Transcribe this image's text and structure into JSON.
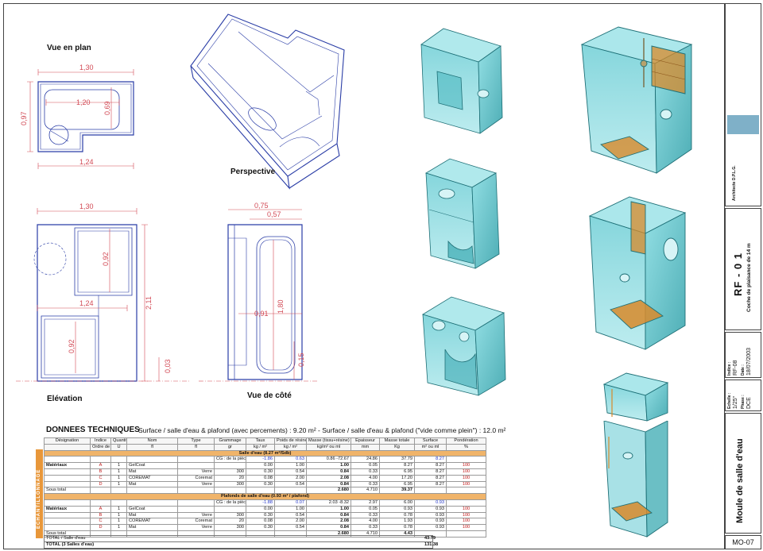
{
  "views": {
    "plan": "Vue en plan",
    "perspective": "Perspective",
    "elevation": "Elévation",
    "side": "Vue de côté"
  },
  "dimensions": {
    "plan_width": "1,30",
    "plan_inner": "1,20",
    "plan_height": "0,97",
    "plan_inner_height": "0,69",
    "plan_bottom": "1,24",
    "elev_width": "1,30",
    "elev_inner_top": "0,92",
    "elev_mid": "1,24",
    "elev_inner_bottom": "0,92",
    "elev_height": "2,11",
    "elev_base": "0,03",
    "side_top_a": "0,75",
    "side_top_b": "0,57",
    "side_inner": "1,80",
    "side_depth": "0,91",
    "side_base": "0,15"
  },
  "title_block": {
    "architect": "Architecte D.P.L.G.",
    "project_code": "RF - 0 1",
    "project_name": "Coche de plaisance de 14 m",
    "indice_label": "Indice :",
    "indice": "RF-08",
    "date_label": "Date :",
    "date": "18/07/2003",
    "echelle_label": "Echelle :",
    "echelle": "1/25°",
    "phase_label": "Phase :",
    "phase": "DCE",
    "drawing_title": "Moule de salle d'eau",
    "drawing_number": "MO-07"
  },
  "data_table": {
    "title": "DONNEES TECHNIQUES",
    "subtitle": "Surface / salle d'eau & plafond (avec percements) : 9.20 m² - Surface / salle d'eau & plafond (\"vide comme plein\") : 12.0 m²",
    "side_label": "ECHANTILLONNAGE",
    "headers": [
      "Désignation",
      "Indice",
      "Quantité",
      "Nom",
      "Type",
      "Grammage",
      "Taux",
      "Poids de résine",
      "Masse (tissu+résine)",
      "Epaisseur",
      "Masse totale",
      "Surface",
      "Pondération"
    ],
    "units": [
      "",
      "Ordre de pose",
      "U",
      "fl",
      "fl",
      "gr",
      "kg / m²",
      "kg / m²",
      "kg/m² ou ml",
      "mm",
      "Kg",
      "m² ou ml",
      "%"
    ],
    "sections": [
      {
        "title": "Salle d'eau (8.27 m²/Sdb)",
        "cg": {
          "label": "CG : de la pièce",
          "a": "-1.86",
          "b": "0.63",
          "c": "0.86",
          "d": "-72.67",
          "e": "24.86",
          "f": "37.79",
          "g": "8.27"
        },
        "rows": [
          {
            "designation": "Matériaux",
            "indice": "A",
            "qte": "1",
            "nom": "GelCoat",
            "type": "",
            "gram": "",
            "taux": "0.00",
            "poids": "1.00",
            "masse": "1.00",
            "ep": "0.05",
            "mt": "8.27",
            "surf": "8.27",
            "pond": "100"
          },
          {
            "designation": "",
            "indice": "B",
            "qte": "1",
            "nom": "Mat",
            "type": "Verre",
            "gram": "300",
            "taux": "0.30",
            "poids": "0.54",
            "masse": "0.84",
            "ep": "0.33",
            "mt": "6.95",
            "surf": "8.27",
            "pond": "100"
          },
          {
            "designation": "",
            "indice": "C",
            "qte": "1",
            "nom": "COREMAT",
            "type": "Coremat",
            "gram": "20",
            "taux": "0.08",
            "poids": "2.00",
            "masse": "2.08",
            "ep": "4.00",
            "mt": "17.20",
            "surf": "8.27",
            "pond": "100"
          },
          {
            "designation": "",
            "indice": "D",
            "qte": "1",
            "nom": "Mat",
            "type": "Verre",
            "gram": "300",
            "taux": "0.30",
            "poids": "0.54",
            "masse": "0.84",
            "ep": "0.33",
            "mt": "6.95",
            "surf": "8.27",
            "pond": "100"
          }
        ],
        "subtotal": {
          "label": "Sous total",
          "masse": "2.680",
          "ep": "4.710",
          "mt": "39.37"
        }
      },
      {
        "title": "Plafonds de salle d'eau (0.93 m² / plafond)",
        "cg": {
          "label": "CG : de la pièce",
          "a": "-1.88",
          "b": "0.07",
          "c": "2.03",
          "d": "-8.32",
          "e": "2.97",
          "f": "6.00",
          "g": "0.93"
        },
        "rows": [
          {
            "designation": "Matériaux",
            "indice": "A",
            "qte": "1",
            "nom": "GelCoat",
            "type": "",
            "gram": "",
            "taux": "0.00",
            "poids": "1.00",
            "masse": "1.00",
            "ep": "0.05",
            "mt": "0.93",
            "surf": "0.93",
            "pond": "100"
          },
          {
            "designation": "",
            "indice": "B",
            "qte": "1",
            "nom": "Mat",
            "type": "Verre",
            "gram": "300",
            "taux": "0.30",
            "poids": "0.54",
            "masse": "0.84",
            "ep": "0.33",
            "mt": "0.78",
            "surf": "0.93",
            "pond": "100"
          },
          {
            "designation": "",
            "indice": "C",
            "qte": "1",
            "nom": "COREMAT",
            "type": "Coremat",
            "gram": "20",
            "taux": "0.08",
            "poids": "2.00",
            "masse": "2.08",
            "ep": "4.00",
            "mt": "1.93",
            "surf": "0.93",
            "pond": "100"
          },
          {
            "designation": "",
            "indice": "D",
            "qte": "1",
            "nom": "Mat",
            "type": "Verre",
            "gram": "300",
            "taux": "0.30",
            "poids": "0.54",
            "masse": "0.84",
            "ep": "0.33",
            "mt": "0.78",
            "surf": "0.93",
            "pond": "100"
          }
        ],
        "subtotal": {
          "label": "Sous total",
          "masse": "2.680",
          "ep": "4.710",
          "mt": "4.43"
        }
      }
    ],
    "total1": {
      "label": "TOTAL / Salle d'eau",
      "value": "43.79"
    },
    "total2": {
      "label": "TOTAL (3 Salles d'eau)",
      "value": "131.38"
    }
  },
  "colors": {
    "accent": "#e8973a",
    "dimension": "#d24a55",
    "line": "#2a3da6",
    "teal": "#3fb7bf",
    "orange": "#d88a2a"
  }
}
